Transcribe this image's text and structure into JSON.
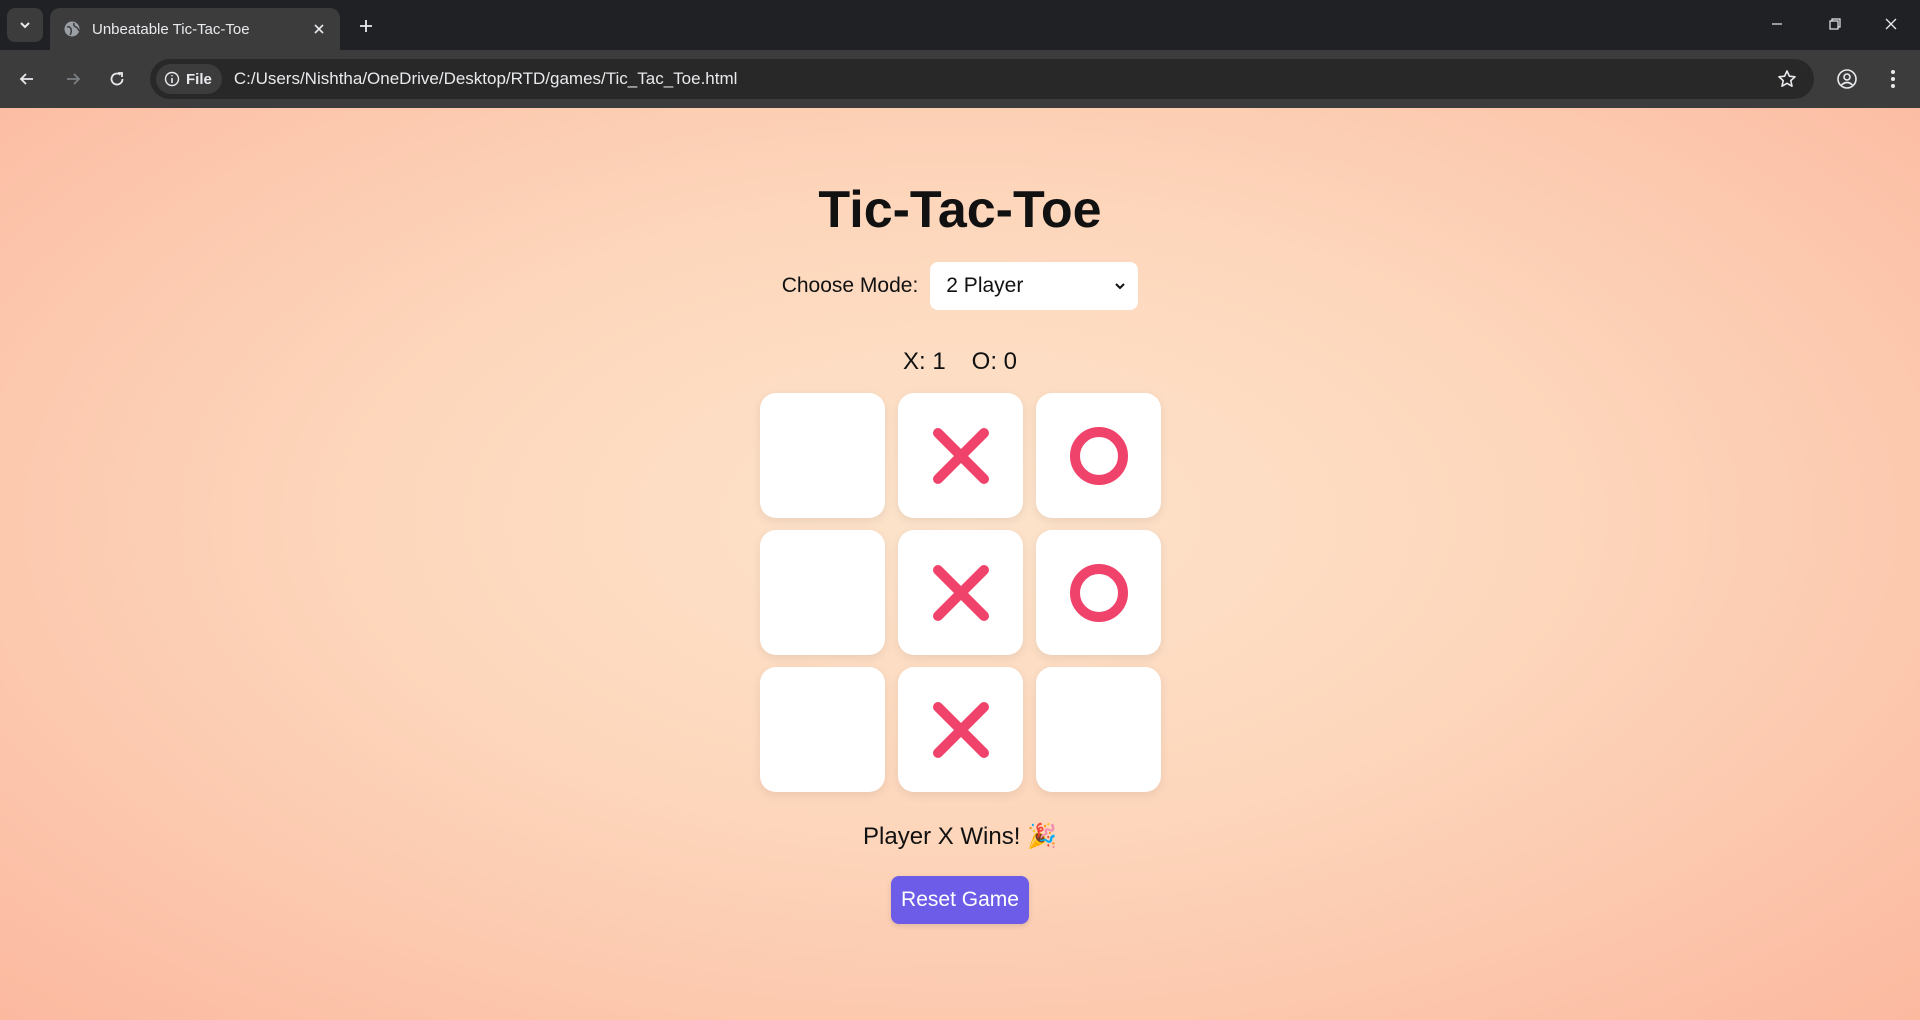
{
  "browser": {
    "tab_title": "Unbeatable Tic-Tac-Toe",
    "file_chip_label": "File",
    "url": "C:/Users/Nishtha/OneDrive/Desktop/RTD/games/Tic_Tac_Toe.html"
  },
  "game": {
    "title": "Tic-Tac-Toe",
    "mode_label": "Choose Mode:",
    "mode_selected": "2 Player",
    "score": {
      "x": "X: 1",
      "o": "O: 0"
    },
    "board": [
      "",
      "X",
      "O",
      "",
      "X",
      "O",
      "",
      "X",
      ""
    ],
    "status": "Player X Wins! 🎉",
    "reset_label": "Reset Game",
    "colors": {
      "mark": "#f0436b",
      "button": "#6c5ce7"
    }
  }
}
